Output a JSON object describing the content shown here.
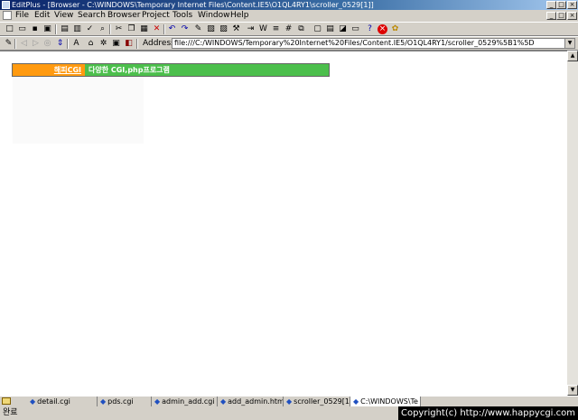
{
  "window": {
    "title": "EditPlus - [Browser - C:\\WINDOWS\\Temporary Internet Files\\Content.IE5\\O1QL4RY1\\scroller_0529[1]]"
  },
  "menu": {
    "items": [
      "File",
      "Edit",
      "View",
      "Search",
      "Browser",
      "Project",
      "Tools",
      "Window",
      "Help"
    ]
  },
  "toolbar1": {
    "icons": [
      "new-file-icon",
      "open-icon",
      "save-icon",
      "save-all-icon",
      "print-preview-icon",
      "print-icon",
      "spellcheck-icon",
      "find-icon",
      "cut-icon",
      "copy-icon",
      "paste-icon",
      "delete-icon",
      "undo-icon",
      "redo-icon",
      "hex-icon",
      "browser-icon",
      "document-icon",
      "tools-icon",
      "window-icon",
      "maximize-icon",
      "tile-icon",
      "cascade-icon",
      "help-icon",
      "stop-icon",
      "settings-icon"
    ]
  },
  "toolbar2": {
    "address_label": "Address",
    "address_value": "file:///C:/WINDOWS/Temporary%20Internet%20Files/Content.IE5/O1QL4RY1/scroller_0529%5B1%5D"
  },
  "banner": {
    "link": "해피CGI",
    "text": "다양한 CGI,php프로그램",
    "colors": {
      "left": "#ff9a10",
      "right": "#4cbf4c"
    }
  },
  "tabs": [
    {
      "label": "detail.cgi"
    },
    {
      "label": "pds.cgi"
    },
    {
      "label": "admin_add.cgi"
    },
    {
      "label": "add_admin.html"
    },
    {
      "label": "scroller_0529[1]"
    },
    {
      "label": "C:\\WINDOWS\\Te"
    }
  ],
  "status": {
    "text": "완료",
    "copyright": "Copyright(c) http://www.happycgi.com"
  }
}
